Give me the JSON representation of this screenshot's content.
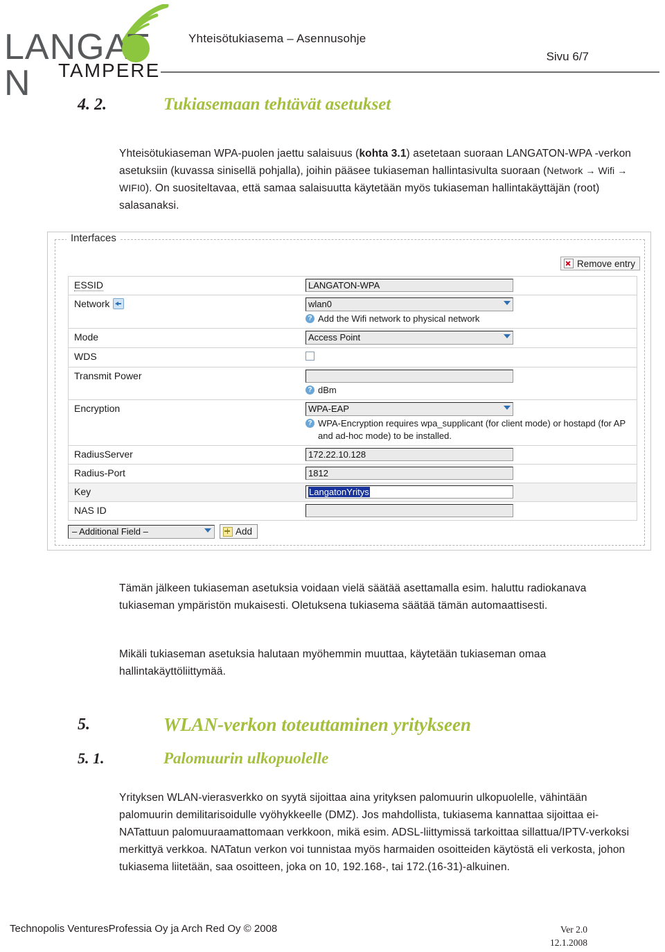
{
  "header": {
    "logo_main": "LANGAT N",
    "logo_sub": "TAMPERE",
    "doc_title": "Yhteisötukiasema – Asennusohje",
    "page_label": "Sivu 6/7",
    "brand_green": "#8cc63e"
  },
  "section_42": {
    "number": "4. 2.",
    "title": "Tukiasemaan tehtävät asetukset",
    "paragraph_part1": "Yhteisötukiaseman WPA-puolen jaettu salaisuus (",
    "paragraph_bold": "kohta 3.1",
    "paragraph_part2": ") asetetaan suoraan LANGATON-WPA -verkon asetuksiin (kuvassa sinisellä pohjalla), joihin pääsee tukiaseman hallintasivulta suoraan (",
    "paragraph_small": "Network → Wifi → WIFI0",
    "paragraph_part3": "). On suositeltavaa, että samaa salaisuutta käytetään myös tukiaseman hallintakäyttäjän (root) salasanaksi."
  },
  "screenshot": {
    "legend": "Interfaces",
    "remove_entry_label": "Remove entry",
    "rows": [
      {
        "label": "ESSID",
        "kind": "text",
        "value": "LANGATON-WPA"
      },
      {
        "label": "Network",
        "kind": "select",
        "value": "wlan0",
        "hint": "Add the Wifi network to physical network"
      },
      {
        "label": "Mode",
        "kind": "select",
        "value": "Access Point"
      },
      {
        "label": "WDS",
        "kind": "checkbox",
        "value": ""
      },
      {
        "label": "Transmit Power",
        "kind": "text",
        "value": "",
        "hint": "dBm"
      },
      {
        "label": "Encryption",
        "kind": "select",
        "value": "WPA-EAP",
        "hint": "WPA-Encryption requires wpa_supplicant (for client mode) or hostapd (for AP and ad-hoc mode) to be installed."
      },
      {
        "label": "RadiusServer",
        "kind": "text",
        "value": "172.22.10.128"
      },
      {
        "label": "Radius-Port",
        "kind": "text",
        "value": "1812"
      },
      {
        "label": "Key",
        "kind": "selected",
        "value": "LangatonYritys"
      },
      {
        "label": "NAS ID",
        "kind": "text",
        "value": ""
      }
    ],
    "additional_field_label": "– Additional Field –",
    "add_button_label": "Add",
    "selection_color": "#17329b"
  },
  "body": {
    "after_paragraph_1": "Tämän jälkeen tukiaseman asetuksia voidaan vielä säätää asettamalla esim. haluttu radiokanava tukiaseman ympäristön mukaisesti. Oletuksena tukiasema säätää tämän automaattisesti.",
    "after_paragraph_2": "Mikäli tukiaseman asetuksia halutaan myöhemmin muuttaa, käytetään tukiaseman omaa hallintakäyttöliittymää."
  },
  "section_5": {
    "number": "5.",
    "title": "WLAN-verkon toteuttaminen yritykseen"
  },
  "section_51": {
    "number": "5. 1.",
    "title": "Palomuurin ulkopuolelle",
    "paragraph": "Yrityksen WLAN-vierasverkko on syytä sijoittaa aina yrityksen palomuurin ulkopuolelle, vähintään palomuurin demilitarisoidulle vyöhykkeelle (DMZ). Jos mahdollista, tukiasema kannattaa sijoittaa ei-NATattuun palomuuraamattomaan verkkoon, mikä esim. ADSL-liittymissä tarkoittaa sillattua/IPTV-verkoksi merkittyä verkkoa. NATatun verkon voi tunnistaa myös harmaiden osoitteiden käytöstä eli verkosta, johon tukiasema liitetään, saa osoitteen, joka on 10, 192.168-, tai 172.(16-31)-alkuinen."
  },
  "footer": {
    "left": "Technopolis VenturesProfessia Oy ja Arch Red Oy © 2008",
    "version": "Ver 2.0",
    "date": "12.1.2008"
  }
}
